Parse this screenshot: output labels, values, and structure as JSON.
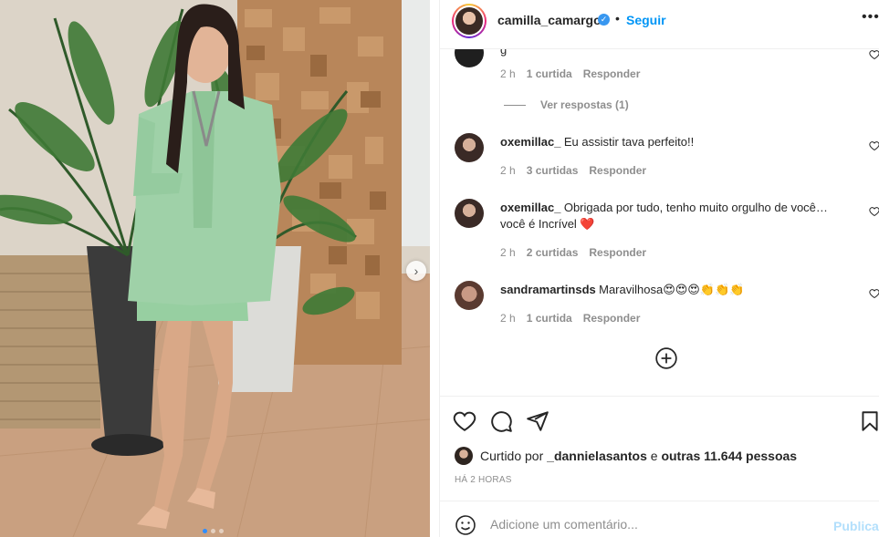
{
  "post": {
    "username": "camilla_camargo",
    "separator": "•",
    "follow_label": "Seguir",
    "more_label": "•••"
  },
  "comments": {
    "first_partial": {
      "text": "g",
      "time": "2 h",
      "likes": "1 curtida",
      "reply": "Responder"
    },
    "view_replies": "Ver respostas (1)",
    "items": [
      {
        "username": "oxemillac_",
        "text": "Eu assistir tava perfeito!!",
        "time": "2 h",
        "likes": "3 curtidas",
        "reply": "Responder"
      },
      {
        "username": "oxemillac_",
        "text": "Obrigada por tudo, tenho muito orgulho de você…",
        "text2": "você é Incrível ❤️",
        "time": "2 h",
        "likes": "2 curtidas",
        "reply": "Responder"
      },
      {
        "username": "sandramartinsds",
        "text": "Maravilhosa😍😍😍👏👏👏",
        "time": "2 h",
        "likes": "1 curtida",
        "reply": "Responder"
      }
    ]
  },
  "likes": {
    "prefix": "Curtido por",
    "user": "_dannielasantos",
    "middle": "e",
    "others": "outras 11.644 pessoas"
  },
  "time_ago": "HÁ 2 HORAS",
  "comment_box": {
    "placeholder": "Adicione um comentário...",
    "publish": "Publicar"
  },
  "carousel": {
    "slides": 3,
    "active": 1
  },
  "colors": {
    "accent": "#0095f6",
    "publish_disabled": "#b2dffc",
    "muted": "#8e8e8e",
    "blazer": "#9fd1a8",
    "heart": "#ed4956"
  },
  "icons": [
    "verified-icon",
    "heart-icon",
    "comment-icon",
    "share-icon",
    "bookmark-icon",
    "plus-circle-icon",
    "emoji-icon",
    "chevron-right-icon"
  ]
}
